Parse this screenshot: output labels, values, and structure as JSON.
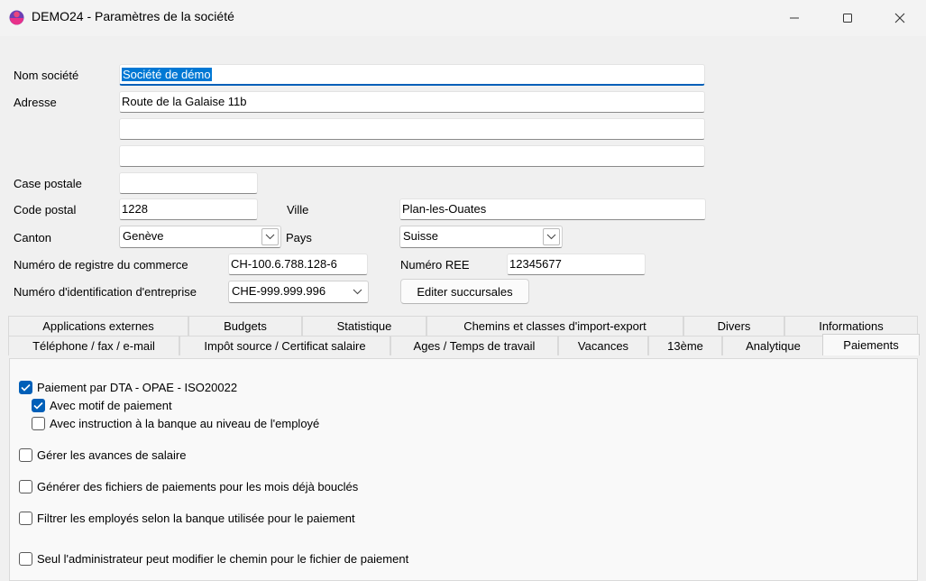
{
  "window": {
    "title": "DEMO24 - Paramètres de la société"
  },
  "form": {
    "nom_label": "Nom société",
    "nom_value": "Société de démo",
    "adresse_label": "Adresse",
    "adresse1": "Route de la Galaise 11b",
    "adresse2": "",
    "adresse3": "",
    "case_postale_label": "Case postale",
    "case_postale_value": "",
    "code_postal_label": "Code postal",
    "code_postal_value": "1228",
    "ville_label": "Ville",
    "ville_value": "Plan-les-Ouates",
    "canton_label": "Canton",
    "canton_value": "Genève",
    "pays_label": "Pays",
    "pays_value": "Suisse",
    "registre_label": "Numéro de registre du commerce",
    "registre_value": "CH-100.6.788.128-6",
    "ree_label": "Numéro REE",
    "ree_value": "12345677",
    "ide_label": "Numéro d'identification d'entreprise",
    "ide_value": "CHE-999.999.996",
    "succursales_button": "Editer succursales"
  },
  "tabs_row1": [
    "Applications externes",
    "Budgets",
    "Statistique",
    "Chemins et classes d'import-export",
    "Divers",
    "Informations"
  ],
  "tabs_row2": [
    "Téléphone / fax / e-mail",
    "Impôt source / Certificat salaire",
    "Ages / Temps de travail",
    "Vacances",
    "13ème",
    "Analytique",
    "Paiements"
  ],
  "active_tab": "Paiements",
  "checkboxes": [
    {
      "label": "Paiement par DTA - OPAE - ISO20022",
      "checked": true
    },
    {
      "label": "Avec motif de paiement",
      "checked": true
    },
    {
      "label": "Avec instruction à la banque au niveau de l'employé",
      "checked": false
    },
    {
      "label": "Gérer les avances de salaire",
      "checked": false
    },
    {
      "label": "Générer des fichiers de paiements pour les mois déjà bouclés",
      "checked": false
    },
    {
      "label": "Filtrer les employés selon la banque utilisée pour le paiement",
      "checked": false
    },
    {
      "label": "Seul l'administrateur peut modifier le chemin pour le fichier de paiement",
      "checked": false
    }
  ],
  "colors": {
    "accent": "#005fb8",
    "selection": "#0078d4",
    "window_bg": "#f0f0f0"
  },
  "icons": {
    "app": "app-logo-icon",
    "minimize": "minimize-icon",
    "maximize": "maximize-icon",
    "close": "close-icon",
    "dropdown": "chevron-down-icon",
    "check": "checkmark-icon"
  }
}
